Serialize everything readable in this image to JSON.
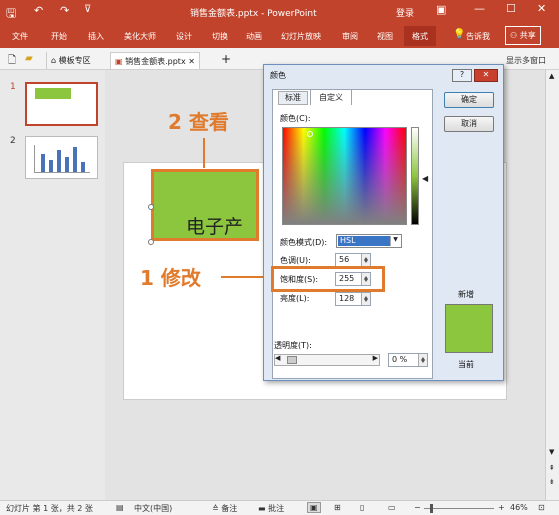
{
  "window": {
    "title": "销售金额表.pptx - PowerPoint",
    "login": "登录"
  },
  "ribbon": {
    "tabs": [
      "文件",
      "开始",
      "插入",
      "美化大师",
      "设计",
      "切换",
      "动画",
      "幻灯片放映",
      "审阅",
      "视图",
      "格式"
    ],
    "active_tab": "格式",
    "tell_me": "告诉我",
    "share": "共享"
  },
  "doc_tabs": {
    "template": "模板专区",
    "file": "销售金额表.pptx",
    "add": "+"
  },
  "thumbnails": [
    {
      "number": "1"
    },
    {
      "number": "2"
    }
  ],
  "slide": {
    "text": "电子产"
  },
  "dialog": {
    "title": "颜色",
    "help": "?",
    "close": "✕",
    "tabs": [
      "标准",
      "自定义"
    ],
    "active_tab": "自定义",
    "colors_label": "颜色(C):",
    "mode_label": "颜色模式(D):",
    "mode_value": "HSL",
    "hue_label": "色调(U):",
    "hue_value": "56",
    "sat_label": "饱和度(S):",
    "sat_value": "255",
    "lum_label": "亮度(L):",
    "lum_value": "128",
    "transparency_label": "透明度(T):",
    "transparency_value": "0 %",
    "ok": "确定",
    "cancel": "取消",
    "new_label": "新增",
    "current_label": "当前",
    "new_color": "#8cc63f",
    "current_color": "#8cc63f"
  },
  "partial_text": "显示多窗口",
  "annotations": {
    "step1": "1 修改",
    "step2": "2 查看",
    "accent": "#e07a2c"
  },
  "status": {
    "slide_info": "幻灯片 第 1 张，共 2 张",
    "language": "中文(中国)",
    "notes": "备注",
    "comments": "批注",
    "zoom": "46%",
    "minus": "−",
    "plus": "+"
  }
}
